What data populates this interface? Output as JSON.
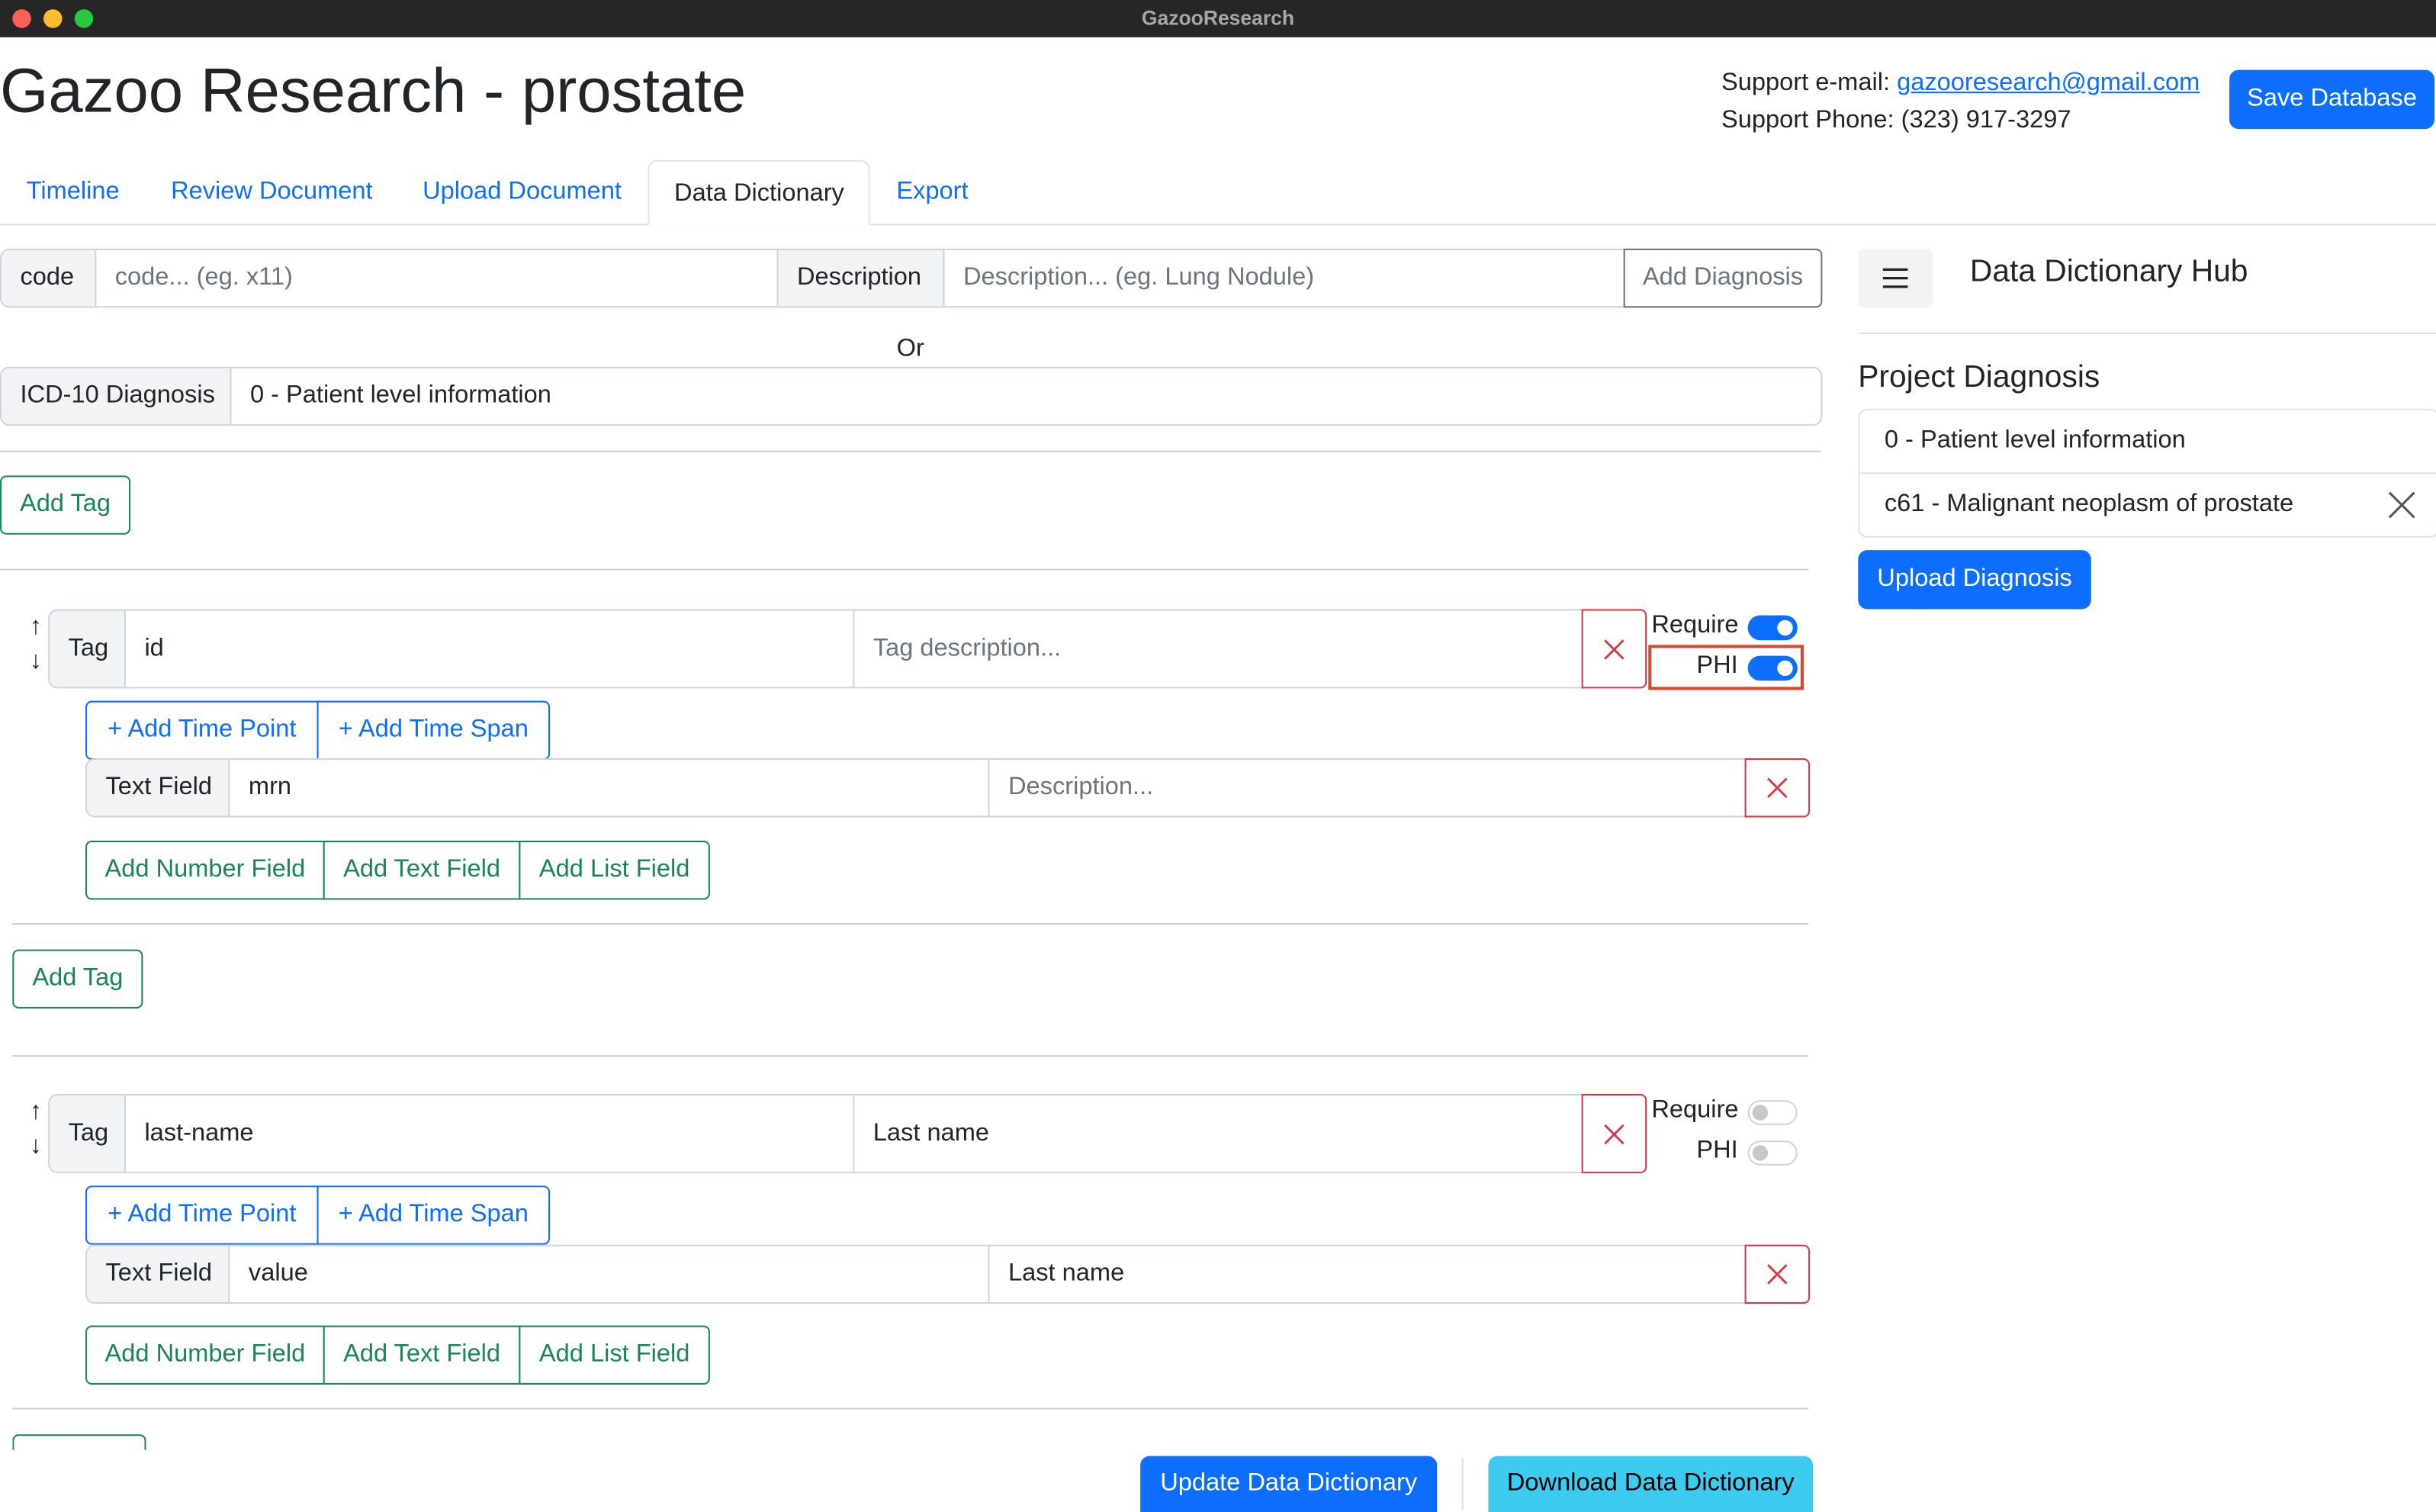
{
  "window": {
    "title": "GazooResearch"
  },
  "header": {
    "title": "Gazoo Research - prostate",
    "support_email_label": "Support e-mail:",
    "support_email": "gazooresearch@gmail.com",
    "support_phone_label": "Support Phone:",
    "support_phone": "(323) 917-3297",
    "save_button": "Save Database"
  },
  "tabs": [
    {
      "label": "Timeline",
      "active": false
    },
    {
      "label": "Review Document",
      "active": false
    },
    {
      "label": "Upload Document",
      "active": false
    },
    {
      "label": "Data Dictionary",
      "active": true
    },
    {
      "label": "Export",
      "active": false
    }
  ],
  "diagnosis_form": {
    "code_label": "code",
    "code_placeholder": "code... (eg. x11)",
    "description_label": "Description",
    "description_placeholder": "Description... (eg. Lung Nodule)",
    "add_button": "Add Diagnosis",
    "or_text": "Or",
    "icd_label": "ICD-10 Diagnosis",
    "icd_value": "0 - Patient level information"
  },
  "add_tag_label": "Add Tag",
  "tags": [
    {
      "tag_label": "Tag",
      "tag_value": "id",
      "description_placeholder": "Tag description...",
      "description_value": "",
      "require_label": "Require",
      "require_on": true,
      "phi_label": "PHI",
      "phi_on": true,
      "add_time_point": "+ Add Time Point",
      "add_time_span": "+ Add Time Span",
      "field": {
        "type_label": "Text Field",
        "value": "mrn",
        "description_placeholder": "Description...",
        "description_value": ""
      },
      "add_number_field": "Add Number Field",
      "add_text_field": "Add Text Field",
      "add_list_field": "Add List Field"
    },
    {
      "tag_label": "Tag",
      "tag_value": "last-name",
      "description_placeholder": "Tag description...",
      "description_value": "Last name",
      "require_label": "Require",
      "require_on": false,
      "phi_label": "PHI",
      "phi_on": false,
      "add_time_point": "+ Add Time Point",
      "add_time_span": "+ Add Time Span",
      "field": {
        "type_label": "Text Field",
        "value": "value",
        "description_placeholder": "Description...",
        "description_value": "Last name"
      },
      "add_number_field": "Add Number Field",
      "add_text_field": "Add Text Field",
      "add_list_field": "Add List Field"
    }
  ],
  "sidebar": {
    "menu_icon": "hamburger-icon",
    "hub_title": "Data Dictionary Hub",
    "project_diagnosis_title": "Project Diagnosis",
    "diagnoses": [
      {
        "label": "0 - Patient level information",
        "removable": false
      },
      {
        "label": "c61 - Malignant neoplasm of prostate",
        "removable": true
      }
    ],
    "upload_button": "Upload Diagnosis"
  },
  "footer": {
    "update_button": "Update Data Dictionary",
    "download_button": "Download Data Dictionary"
  },
  "colors": {
    "primary": "#0d6efd",
    "success": "#198754",
    "danger": "#dc3545",
    "info": "#3dcbef",
    "highlight": "#e0452e"
  }
}
